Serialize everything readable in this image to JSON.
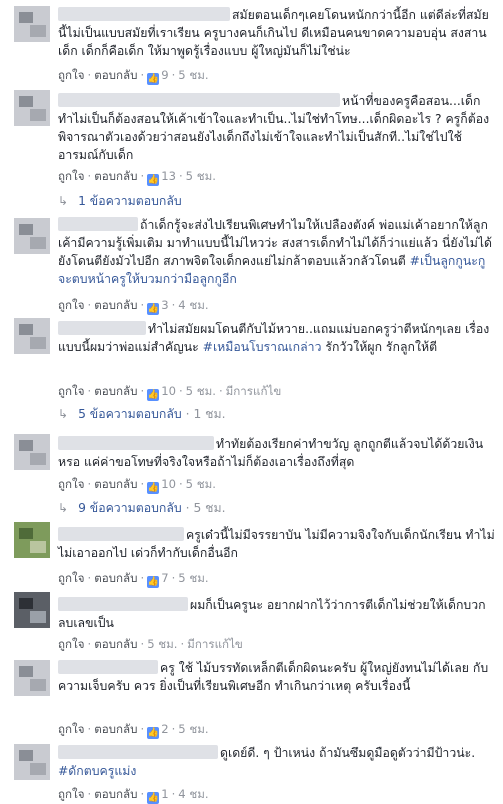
{
  "actions": {
    "like": "ถูกใจ",
    "reply": "ตอบกลับ",
    "edited": "มีการแก้ไข"
  },
  "comments": [
    {
      "text": "สมัยตอนเด็กๆเคยโดนหนักกว่านี้อีก แต่ดีล่ะที่สมัยนี้ไม่เป็นแบบสมัยที่เราเรียน ครูบางคนก็เกินไป ดีเหมือนคนขาดความอบอุ่น สงสานเด็ก เด็กก็คือเด็ก ให้มาพูดรู้เรื่องแบบ ผู้ใหญ่มันก็ไม่ใช่น่ะ",
      "likes": "9",
      "time": "5 ชม."
    },
    {
      "text": "หน้าที่ของครูคือสอน...เด็กทำไม่เป็นก็ต้องสอนให้เค้าเข้าใจและทำเป็น..ไม่ใช่ทำโทษ...เด็กผิดอะไร ? ครูก็ต้องพิจารณาตัวเองด้วยว่าสอนยังไงเด็กถึงไม่เข้าใจและทำไม่เป็นสักที..ไม่ใช่ไปใช้อารมณ์กับเด็ก",
      "likes": "13",
      "time": "5 ชม.",
      "replies": "1 ข้อความตอบกลับ"
    },
    {
      "text_a": "ถ้าเด็กรู้จะส่งไปเรียนพิเศษทำไมให้เปลืองตังค์ พ่อแม่เค้าอยากให้ลูกเค้ามีความรู้เพิ่มเติม มาทำแบบนี้ไม่ไหวว่ะ สงสารเด็กทำไม่ได้ก็ว่าแย่แล้ว นี่ยังไม่ได้ยังโดนตียังมัวไปอีก สภาพจิตใจเด็กคงแย่ไม่กล้าตอบแล้วกลัวโดนตี",
      "hashtag": "#เป็นลูกกูนะกูจะตบหน้าครูให้บวมกว่ามือลูกกูอีก",
      "likes": "3",
      "time": "4 ชม."
    },
    {
      "text_a": "ทำไม่สมัยผมโดนตีกับไม้หวาย..แถมแม่บอกครูว่าตีหนักๆเลย เรื่องแบบนี้ผมว่าพ่อแม่สำคัญนะ",
      "hashtag": "#เหมือนโบราณเกล่าว",
      "text_b": " รักวัวให้ผูก รักลูกให้ตี",
      "likes": "10",
      "time": "5 ชม.",
      "replies": "5 ข้อความตอบกลับ",
      "replies_time": "1 ชม."
    },
    {
      "text": "ทำทัยต้องเรียกค่าทำขวัญ ลูกถูกตีแล้วจบได้ด้วยเงินหรอ แค่ค่าขอโทษที่จริงใจหรือถ้าไม่ก็ต้องเอาเรื่องถึงที่สุด",
      "likes": "10",
      "time": "5 ชม.",
      "replies": "9 ข้อความตอบกลับ",
      "replies_time": "5 ชม."
    },
    {
      "text": "ครูเด๋วนี้ไม่มีจรรยาบัน ไม่มีความจิงใจกับเด็กนักเรียน ทำไม่ไม่เอาออกไป เด่วก็ทำกับเด็กอื่นอีก",
      "likes": "7",
      "time": "5 ชม."
    },
    {
      "text": "ผมก็เป็นครูนะ อยากฝากไว้ว่าการตีเด็กไม่ช่วยให้เด็กบวกลบเลขเป็น",
      "time": "5 ชม."
    },
    {
      "text": "ครู ใช้ ไม้บรรทัดเหล็กตีเด็กผิดนะครับ ผู้ใหญ่ยังทนไม่ได้เลย กับความเจ็บครับ ควร ยิ่งเป็นที่เรียนพิเศษอีก ทำเกินกว่าเหตุ ครับเรื่องนี้",
      "likes": "2",
      "time": "5 ชม."
    },
    {
      "text_a": "ดูเดย์ดี. ๆ ป้าเหน่ง ถ้ามันซึมดูมือดูตัวว่ามีป้าวน่ะ. ",
      "hashtag": "#ดักตบครูแม่ง",
      "likes": "1",
      "time": "4 ชม."
    }
  ]
}
